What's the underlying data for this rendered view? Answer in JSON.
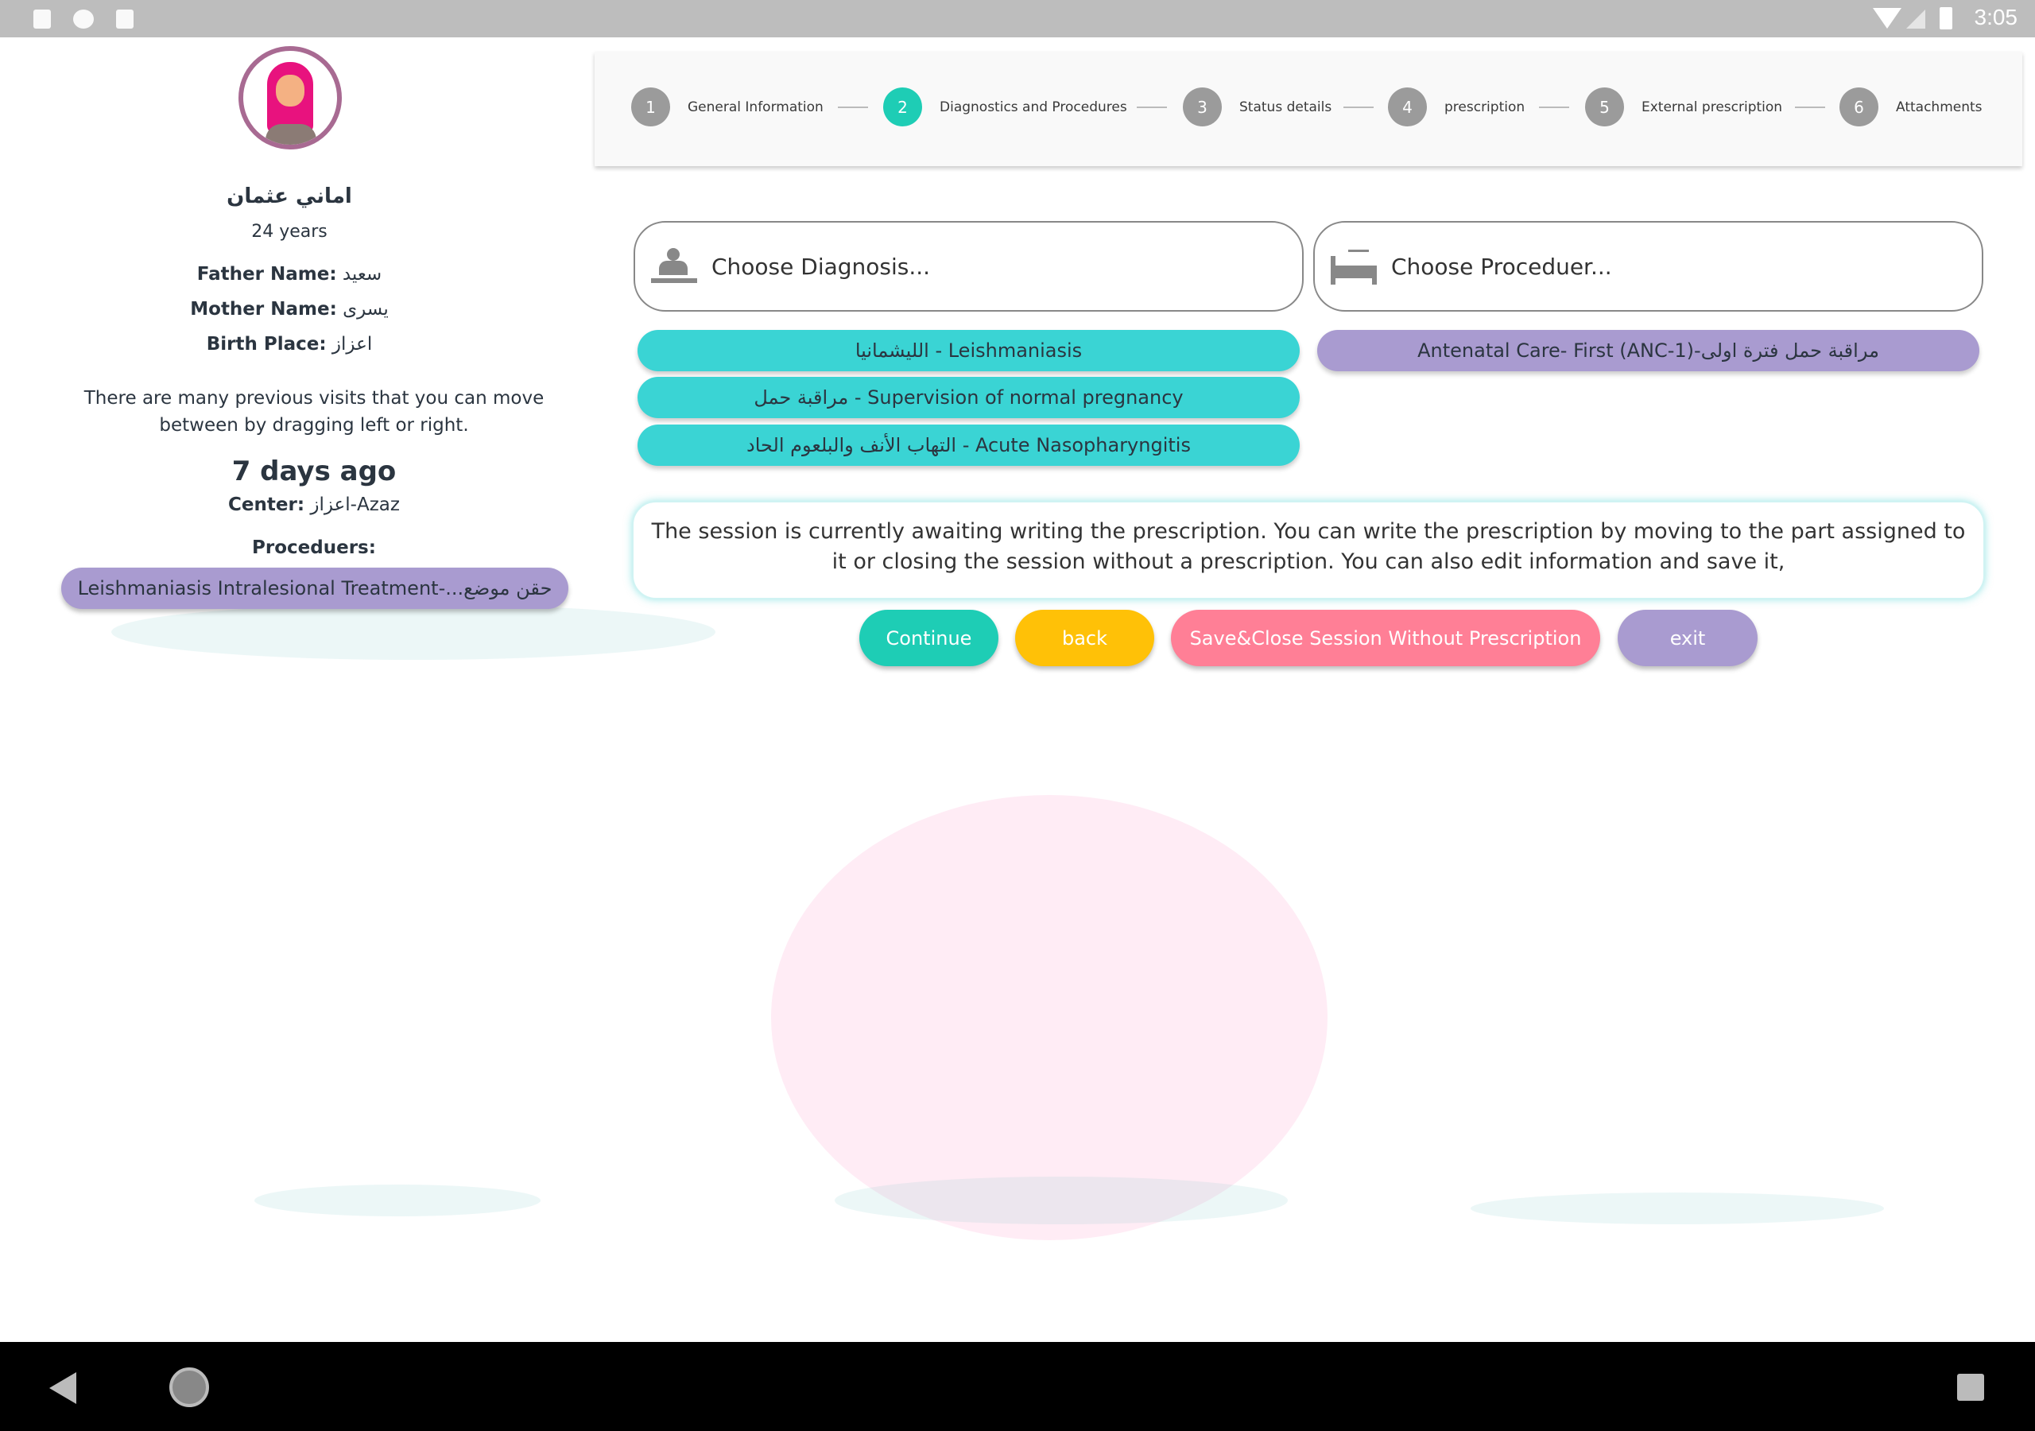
{
  "status_bar": {
    "time": "3:05",
    "icons": [
      "a-icon",
      "circle-icon",
      "sd-card-icon",
      "wifi-icon",
      "signal-icon",
      "battery-icon"
    ]
  },
  "stepper": {
    "steps": [
      {
        "number": "1",
        "label": "General Information",
        "active": false
      },
      {
        "number": "2",
        "label": "Diagnostics and Procedures",
        "active": true
      },
      {
        "number": "3",
        "label": "Status details",
        "active": false
      },
      {
        "number": "4",
        "label": "prescription",
        "active": false
      },
      {
        "number": "5",
        "label": "External prescription",
        "active": false
      },
      {
        "number": "6",
        "label": "Attachments",
        "active": false
      }
    ]
  },
  "patient": {
    "name": "اماني عثمان",
    "age": "24 years",
    "father_label": "Father Name:",
    "father": "سعيد",
    "mother_label": "Mother Name:",
    "mother": "يسرى",
    "birth_label": "Birth Place:",
    "birth": "اعزاز",
    "hint": "There are many previous visits that you can move between by dragging left or right.",
    "visit_time": "7 days ago",
    "center_label": "Center:",
    "center": "اعزاز-Azaz",
    "procedures_label": "Proceduers:",
    "procedure": "Leishmaniasis Intralesional Treatment-...حقن موضع"
  },
  "diagnosis": {
    "placeholder": "Choose Diagnosis...",
    "items": [
      "الليشمانيا - Leishmaniasis",
      "مراقبة حمل - Supervision of normal pregnancy",
      "التهاب الأنف والبلعوم الحاد - Acute Nasopharyngitis"
    ]
  },
  "procedure": {
    "placeholder": "Choose Proceduer...",
    "items": [
      "مراقبة حمل فترة اولى-(ANC-1) Antenatal Care- First"
    ]
  },
  "message": "The session is currently awaiting writing the prescription. You can write the prescription by moving to the part assigned to it or closing the session without a prescription. You can also edit information and save it,",
  "buttons": {
    "continue": "Continue",
    "back": "back",
    "save_close": "Save&Close Session Without Prescription",
    "exit": "exit"
  },
  "colors": {
    "teal": "#1ecdb5",
    "chip_teal": "#3ad4d4",
    "purple": "#a99bd0",
    "yellow": "#ffc107",
    "pink": "#ff7f96"
  }
}
